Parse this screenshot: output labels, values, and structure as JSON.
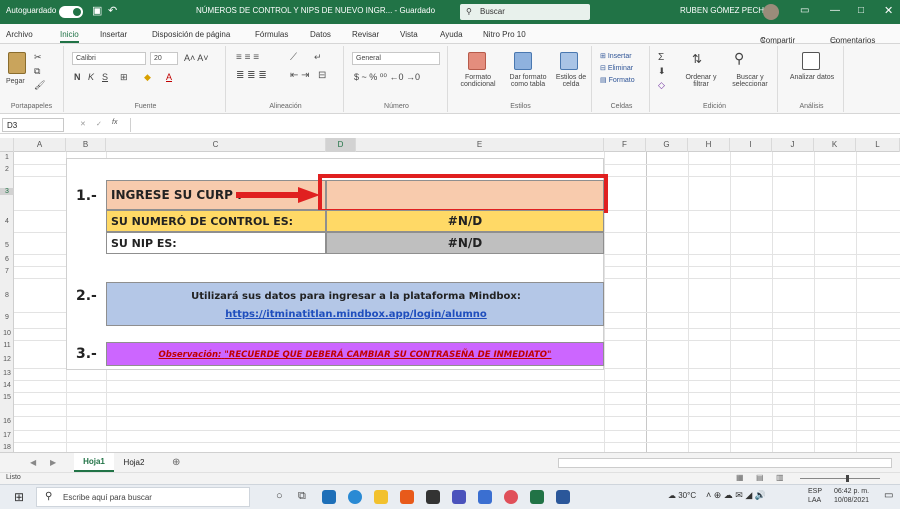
{
  "titlebar": {
    "autosave": "Autoguardado",
    "file_title": "NÚMEROS DE CONTROL Y NIPS DE NUEVO INGR... - Guardado",
    "search": "Buscar",
    "user": "RUBEN GÓMEZ PECH"
  },
  "tabs": [
    "Archivo",
    "Inicio",
    "Insertar",
    "Disposición de página",
    "Fórmulas",
    "Datos",
    "Revisar",
    "Vista",
    "Ayuda",
    "Nitro Pro 10"
  ],
  "share": "Compartir",
  "comments": "Comentarios",
  "ribbon": {
    "clipboard": {
      "paste": "Pegar",
      "label": "Portapapeles"
    },
    "font": {
      "name": "Calibri",
      "size": "20",
      "label": "Fuente"
    },
    "alignment": {
      "label": "Alineación"
    },
    "number": {
      "format": "General",
      "label": "Número"
    },
    "styles": {
      "conditional": "Formato condicional",
      "as_table": "Dar formato como tabla",
      "cell_styles": "Estilos de celda",
      "label": "Estilos"
    },
    "cells": {
      "insert": "Insertar",
      "delete": "Eliminar",
      "format": "Formato",
      "label": "Celdas"
    },
    "editing": {
      "sort": "Ordenar y filtrar",
      "find": "Buscar y seleccionar",
      "label": "Edición"
    },
    "analysis": {
      "analyze": "Analizar datos",
      "label": "Análisis"
    }
  },
  "formula_bar": {
    "cell_ref": "D3",
    "content": ""
  },
  "columns": [
    "A",
    "B",
    "C",
    "D",
    "E",
    "F",
    "G",
    "H",
    "I",
    "J",
    "K",
    "L"
  ],
  "rows": [
    "1",
    "2",
    "3",
    "4",
    "5",
    "6",
    "7",
    "8",
    "9",
    "10",
    "11",
    "12",
    "13",
    "14",
    "15",
    "16",
    "17",
    "18"
  ],
  "sheet": {
    "step1": "1.-",
    "curp_label": "INGRESE SU CURP :",
    "control_label": "SU NUMERÓ DE CONTROL ES:",
    "control_value": "#N/D",
    "nip_label": "SU NIP ES:",
    "nip_value": "#N/D",
    "step2": "2.-",
    "info_text": "Utilizará sus datos para ingresar a la plataforma Mindbox:",
    "info_link": "https://itminatitlan.mindbox.app/login/alumno",
    "step3": "3.-",
    "note_prefix": "Observación:",
    "note_text": "\"RECUERDE QUE DEBERÁ CAMBIAR SU CONTRASEÑA DE INMEDIATO\""
  },
  "sheet_tabs": [
    "Hoja1",
    "Hoja2"
  ],
  "status_text": "Listo",
  "taskbar": {
    "search_placeholder": "Escribe aquí para buscar",
    "temperature": "30°C",
    "lang": "ESP",
    "lang2": "LAA",
    "time": "06:42 p. m.",
    "date": "10/08/2021"
  },
  "colors": {
    "excel_green": "#217346",
    "curp_fill": "#f8cbad",
    "control_fill": "#ffd966",
    "nip_fill": "#bfbfbf",
    "info_fill": "#b4c7e7",
    "note_fill": "#cc66ff",
    "highlight_red": "#e02020"
  }
}
